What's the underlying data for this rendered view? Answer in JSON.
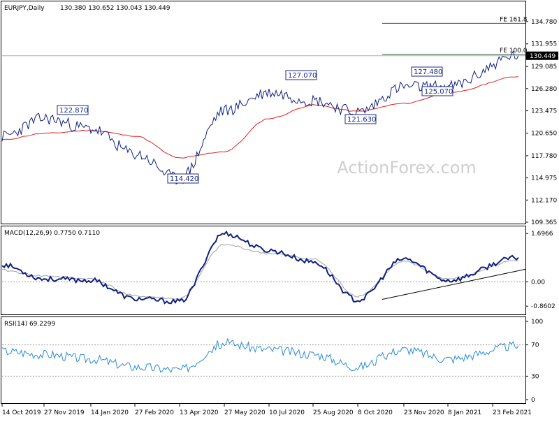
{
  "chart_data": [
    {
      "type": "line",
      "panel": "price",
      "title": "EURJPY,Daily",
      "ohlc_text": "130.380 130.652 130.043 130.449",
      "watermark": "ActionForex.com",
      "last_price": "130.449",
      "ylim": [
        109.365,
        136.8
      ],
      "y_ticks": [
        "134.780",
        "131.955",
        "129.085",
        "126.280",
        "123.475",
        "120.650",
        "117.780",
        "114.975",
        "112.170",
        "109.365"
      ],
      "annotations": [
        {
          "text": "122.870",
          "x": "27 Nov 2019",
          "value": 122.87
        },
        {
          "text": "114.420",
          "x": "13 Apr 2020",
          "value": 114.42
        },
        {
          "text": "127.070",
          "x": "10 Jul 2020",
          "value": 127.07
        },
        {
          "text": "121.630",
          "x": "8 Oct 2020",
          "value": 121.63
        },
        {
          "text": "127.480",
          "x": "23 Nov 2020",
          "value": 127.48
        },
        {
          "text": "125.070",
          "x": "8 Jan 2021",
          "value": 125.07
        }
      ],
      "fib_levels": [
        {
          "text": "FE 161.8",
          "value": 134.55
        },
        {
          "text": "FE 100.0",
          "value": 130.62
        }
      ],
      "series": [
        {
          "color": "#102080",
          "x": [
            "14 Oct 2019",
            "27 Nov 2019",
            "14 Jan 2020",
            "27 Feb 2020",
            "13 Apr 2020",
            "27 May 2020",
            "10 Jul 2020",
            "25 Aug 2020",
            "8 Oct 2020",
            "23 Nov 2020",
            "8 Jan 2021",
            "23 Feb 2021"
          ],
          "values": [
            120.2,
            122.5,
            121.2,
            118.0,
            114.8,
            123.5,
            125.8,
            124.8,
            123.3,
            126.5,
            126.5,
            130.5
          ]
        },
        {
          "color": "#e02020",
          "x": [
            "14 Oct 2019",
            "27 Nov 2019",
            "14 Jan 2020",
            "27 Feb 2020",
            "13 Apr 2020",
            "27 May 2020",
            "10 Jul 2020",
            "25 Aug 2020",
            "8 Oct 2020",
            "23 Nov 2020",
            "8 Jan 2021",
            "23 Feb 2021"
          ],
          "values": [
            119.8,
            120.6,
            121.0,
            120.3,
            117.5,
            118.3,
            122.5,
            124.2,
            123.4,
            124.4,
            125.7,
            127.8
          ]
        }
      ]
    },
    {
      "type": "line",
      "panel": "macd",
      "title": "MACD(12,26,9) 0.7750 0.7110",
      "ylim": [
        -1.1,
        1.85
      ],
      "y_ticks": [
        "1.6966",
        "0.00",
        "-0.8602"
      ],
      "series": [
        {
          "color": "#102080",
          "x": [
            "14 Oct 2019",
            "27 Nov 2019",
            "14 Jan 2020",
            "27 Feb 2020",
            "13 Apr 2020",
            "27 May 2020",
            "10 Jul 2020",
            "25 Aug 2020",
            "8 Oct 2020",
            "23 Nov 2020",
            "8 Jan 2021",
            "23 Feb 2021"
          ],
          "values": [
            0.6,
            0.1,
            0.05,
            -0.6,
            -0.7,
            1.7,
            1.1,
            0.7,
            -0.65,
            0.8,
            0.05,
            0.85
          ]
        },
        {
          "color": "#a0a0a0",
          "x": [
            "14 Oct 2019",
            "27 Nov 2019",
            "14 Jan 2020",
            "27 Feb 2020",
            "13 Apr 2020",
            "27 May 2020",
            "10 Jul 2020",
            "25 Aug 2020",
            "8 Oct 2020",
            "23 Nov 2020",
            "8 Jan 2021",
            "23 Feb 2021"
          ],
          "values": [
            0.4,
            0.2,
            0.1,
            -0.5,
            -0.6,
            1.3,
            1.0,
            0.8,
            -0.5,
            0.7,
            0.1,
            0.75
          ]
        }
      ],
      "trendline": {
        "x": [
          "8 Oct 2020",
          "23 Feb 2021"
        ],
        "values": [
          -0.62,
          0.44
        ]
      }
    },
    {
      "type": "line",
      "panel": "rsi",
      "title": "RSI(14) 69.2299",
      "ylim": [
        0,
        100
      ],
      "y_ticks": [
        "100",
        "70",
        "30",
        "0"
      ],
      "levels": [
        70,
        30
      ],
      "series": [
        {
          "color": "#2a8ad8",
          "x": [
            "14 Oct 2019",
            "27 Nov 2019",
            "14 Jan 2020",
            "27 Feb 2020",
            "13 Apr 2020",
            "27 May 2020",
            "10 Jul 2020",
            "25 Aug 2020",
            "8 Oct 2020",
            "23 Nov 2020",
            "8 Jan 2021",
            "23 Feb 2021"
          ],
          "values": [
            62,
            58,
            52,
            42,
            38,
            72,
            64,
            58,
            42,
            64,
            52,
            69
          ]
        }
      ]
    }
  ],
  "x_axis": {
    "labels": [
      "14 Oct 2019",
      "27 Nov 2019",
      "14 Jan 2020",
      "27 Feb 2020",
      "13 Apr 2020",
      "27 May 2020",
      "10 Jul 2020",
      "25 Aug 2020",
      "8 Oct 2020",
      "23 Nov 2020",
      "8 Jan 2021",
      "23 Feb 2021"
    ]
  }
}
